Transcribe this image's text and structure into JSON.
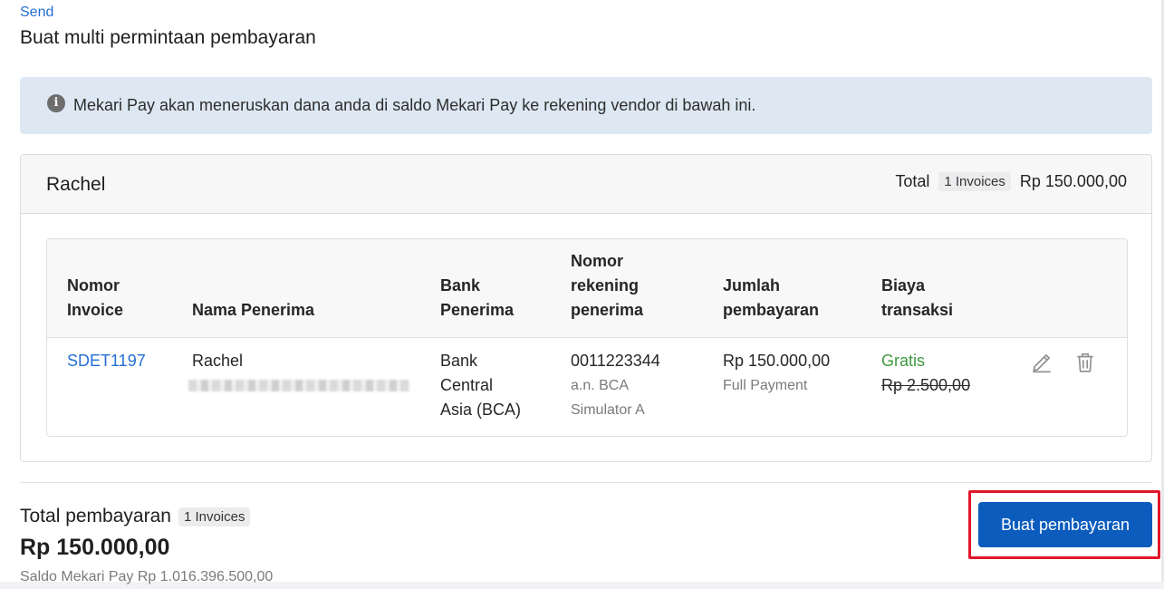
{
  "header": {
    "breadcrumb": "Send",
    "title": "Buat multi permintaan pembayaran"
  },
  "banner": {
    "icon": "info-icon",
    "text": "Mekari Pay akan meneruskan dana anda di saldo Mekari Pay ke rekening vendor di bawah ini."
  },
  "vendor": {
    "name": "Rachel",
    "total_label": "Total",
    "invoice_badge": "1 Invoices",
    "total_amount": "Rp 150.000,00"
  },
  "table": {
    "headers": {
      "invoice_line1": "Nomor",
      "invoice_line2": "Invoice",
      "recipient": "Nama Penerima",
      "bank_line1": "Bank",
      "bank_line2": "Penerima",
      "account_line1": "Nomor",
      "account_line2": "rekening",
      "account_line3": "penerima",
      "amount_line1": "Jumlah",
      "amount_line2": "pembayaran",
      "fee_line1": "Biaya",
      "fee_line2": "transaksi"
    },
    "rows": [
      {
        "invoice": "SDET1197",
        "recipient": "Rachel",
        "bank_line1": "Bank",
        "bank_line2": "Central",
        "bank_line3": "Asia (BCA)",
        "account_number": "0011223344",
        "account_holder_line1": "a.n. BCA",
        "account_holder_line2": "Simulator A",
        "amount": "Rp 150.000,00",
        "payment_type": "Full Payment",
        "fee": "Gratis",
        "original_fee": "Rp 2.500,00"
      }
    ]
  },
  "summary": {
    "label": "Total pembayaran",
    "invoice_badge": "1 Invoices",
    "amount": "Rp 150.000,00",
    "balance": "Saldo Mekari Pay Rp 1.016.396.500,00"
  },
  "actions": {
    "pay_button": "Buat pembayaran"
  },
  "colors": {
    "accent": "#0b5cbd",
    "link": "#246fd3",
    "free": "#3f9a3f",
    "highlight": "#e2152a",
    "banner_bg": "#dde8f3"
  }
}
